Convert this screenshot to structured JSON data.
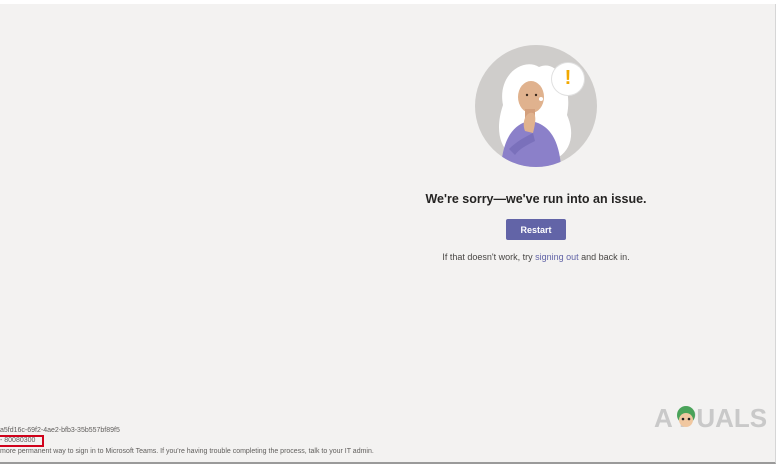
{
  "error_page": {
    "headline": "We're sorry—we've run into an issue.",
    "restart_label": "Restart",
    "helper_prefix": "If that doesn't work, try ",
    "helper_link": "signing out",
    "helper_suffix": " and back in.",
    "bubble_mark": "!"
  },
  "diagnostics": {
    "session_id": "a5fd16c-69f2-4ae2-bfb3-35b557bf89f5",
    "error_code": "- 80080300",
    "footer_note": "more permanent way to sign in to Microsoft Teams. If you're having trouble completing the process, talk to your IT admin."
  },
  "watermark": {
    "text": "A  PUALS"
  },
  "colors": {
    "background": "#f3f2f1",
    "accent": "#6264a7",
    "highlight_box": "#d0021b",
    "exclamation": "#f2a900"
  },
  "icons": [
    "confused-woman-illustration",
    "speech-bubble-icon",
    "exclamation-icon"
  ]
}
